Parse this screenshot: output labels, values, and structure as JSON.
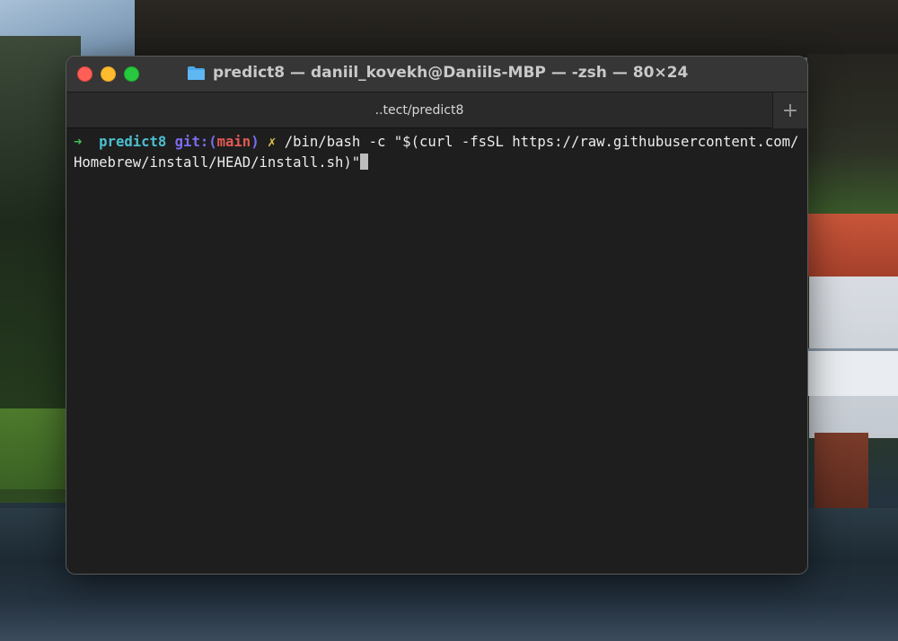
{
  "window": {
    "title": "predict8 — daniil_kovekh@Daniils-MBP — -zsh — 80×24",
    "folder_icon": "folder-icon",
    "traffic_lights": {
      "close_color": "#fe5f57",
      "minimize_color": "#febc2e",
      "zoom_color": "#28c840"
    }
  },
  "tabs": {
    "active_label": "..tect/predict8",
    "add_label": "+"
  },
  "prompt": {
    "arrow": "➜",
    "directory": "predict8",
    "git_prefix": "git:(",
    "branch": "main",
    "git_suffix": ")",
    "dirty_marker": "✗",
    "command": "/bin/bash -c \"$(curl -fsSL https://raw.githubusercontent.com/Homebrew/install/HEAD/install.sh)\""
  },
  "colors": {
    "terminal_bg": "#1e1e1e",
    "titlebar_bg": "#363636",
    "prompt_arrow": "#3fbf5a",
    "prompt_dir": "#4bc0d0",
    "prompt_git": "#7c6cf0",
    "prompt_branch": "#e05a55",
    "prompt_dirty": "#e2c14c"
  }
}
